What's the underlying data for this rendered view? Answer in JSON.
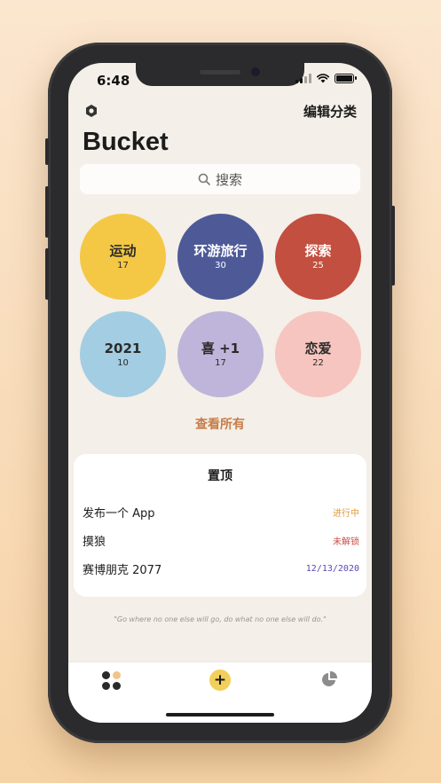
{
  "status": {
    "time": "6:48"
  },
  "header": {
    "edit_categories": "编辑分类",
    "title": "Bucket"
  },
  "search": {
    "placeholder": "搜索"
  },
  "categories": [
    {
      "name": "运动",
      "count": "17",
      "color": "#f4c845",
      "text_color": "#2a2a2a"
    },
    {
      "name": "环游旅行",
      "count": "30",
      "color": "#4e5a98",
      "text_color": "#ffffff"
    },
    {
      "name": "探索",
      "count": "25",
      "color": "#c24f3f",
      "text_color": "#ffffff"
    },
    {
      "name": "2021",
      "count": "10",
      "color": "#a3cde2",
      "text_color": "#2a2a2a"
    },
    {
      "name": "喜 +1",
      "count": "17",
      "color": "#bfb5da",
      "text_color": "#2a2a2a"
    },
    {
      "name": "恋爱",
      "count": "22",
      "color": "#f6c5bf",
      "text_color": "#2a2a2a"
    }
  ],
  "see_all": "查看所有",
  "pinned": {
    "title": "置顶",
    "items": [
      {
        "name": "发布一个 App",
        "status": "进行中",
        "status_color": "#e29a3b"
      },
      {
        "name": "摸狼",
        "status": "未解锁",
        "status_color": "#c9504a"
      },
      {
        "name": "赛博朋克 2077",
        "status": "12/13/2020",
        "status_color": "#5a48b8"
      }
    ]
  },
  "quote": "\"Go where no one else will go, do what no one else will do.\"",
  "tabbar": {
    "dots_colors": [
      "#2a2a2a",
      "#f2c48a",
      "#2a2a2a",
      "#2a2a2a"
    ],
    "add_label": "+"
  }
}
